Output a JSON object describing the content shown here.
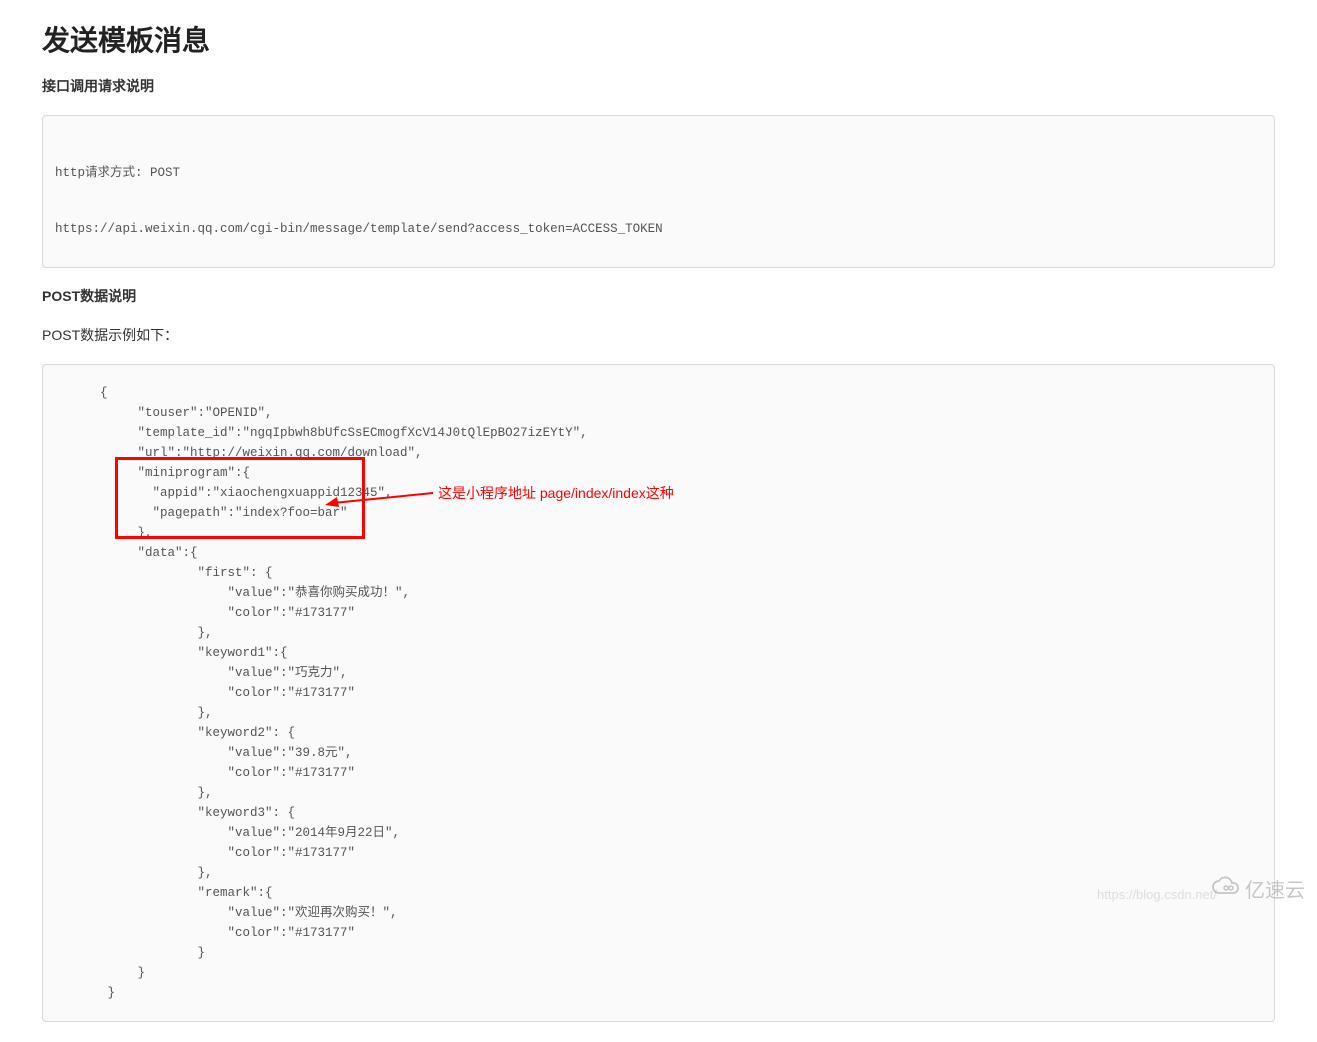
{
  "heading": "发送模板消息",
  "section1_title": "接口调用请求说明",
  "http_box": {
    "line1": "http请求方式: POST",
    "line2": "https://api.weixin.qq.com/cgi-bin/message/template/send?access_token=ACCESS_TOKEN"
  },
  "section2_title": "POST数据说明",
  "paragraph": "POST数据示例如下：",
  "annotation_text": "这是小程序地址 page/index/index这种",
  "json_lines": {
    "l0": "      {",
    "l1": "           \"touser\":\"OPENID\",",
    "l2": "           \"template_id\":\"ngqIpbwh8bUfcSsECmogfXcV14J0tQlEpBO27izEYtY\",",
    "l3": "           \"url\":\"http://weixin.qq.com/download\",  ",
    "l4": "           \"miniprogram\":{",
    "l5": "             \"appid\":\"xiaochengxuappid12345\",",
    "l6": "             \"pagepath\":\"index?foo=bar\"",
    "l7": "           },          ",
    "l8": "           \"data\":{",
    "l9": "                   \"first\": {",
    "l10": "                       \"value\":\"恭喜你购买成功！\",",
    "l11": "                       \"color\":\"#173177\"",
    "l12": "                   },",
    "l13": "                   \"keyword1\":{",
    "l14": "                       \"value\":\"巧克力\",",
    "l15": "                       \"color\":\"#173177\"",
    "l16": "                   },",
    "l17": "                   \"keyword2\": {",
    "l18": "                       \"value\":\"39.8元\",",
    "l19": "                       \"color\":\"#173177\"",
    "l20": "                   },",
    "l21": "                   \"keyword3\": {",
    "l22": "                       \"value\":\"2014年9月22日\",",
    "l23": "                       \"color\":\"#173177\"",
    "l24": "                   },",
    "l25": "                   \"remark\":{",
    "l26": "                       \"value\":\"欢迎再次购买！\",",
    "l27": "                       \"color\":\"#173177\"",
    "l28": "                   }",
    "l29": "           }",
    "l30": "       }"
  },
  "watermark_text": "亿速云",
  "faint_url": "https://blog.csdn.net/"
}
